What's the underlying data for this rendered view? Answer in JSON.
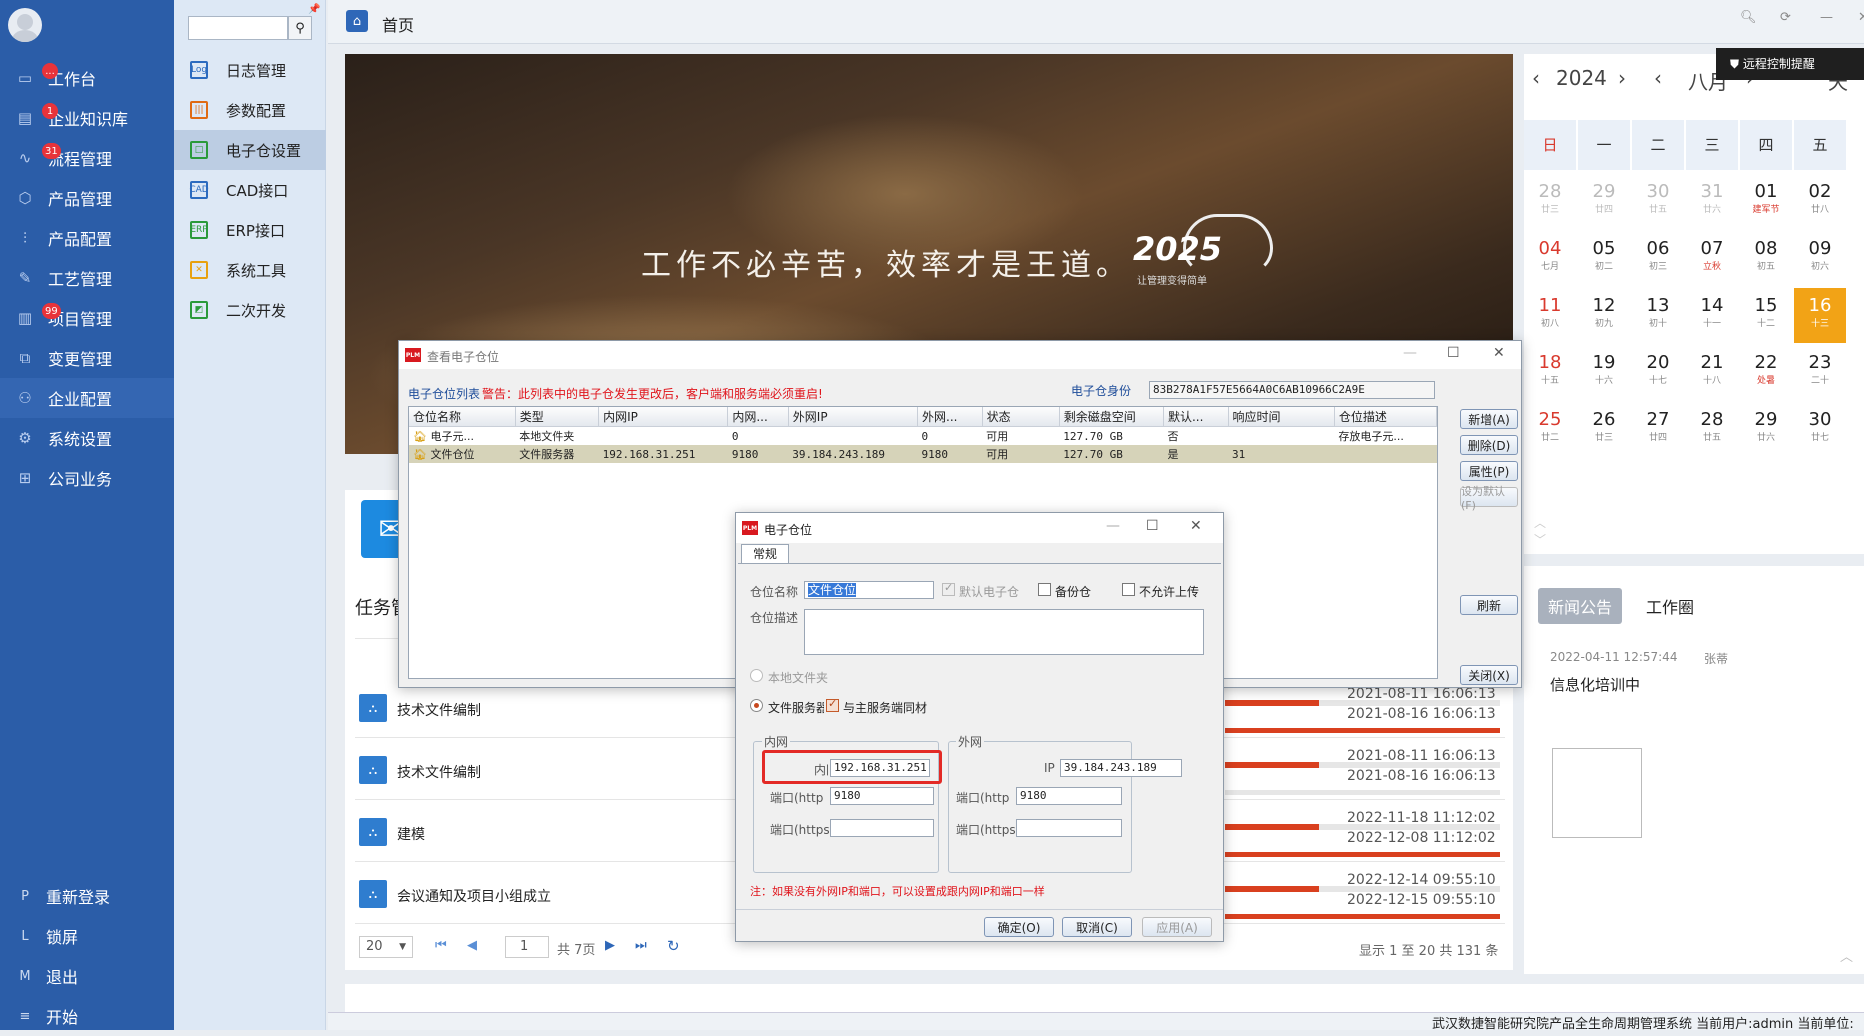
{
  "sidebar": {
    "items": [
      {
        "label": "工作台",
        "badge": "..."
      },
      {
        "label": "企业知识库",
        "badge": "1"
      },
      {
        "label": "流程管理",
        "badge": "31"
      },
      {
        "label": "产品管理",
        "badge": ""
      },
      {
        "label": "产品配置",
        "badge": ""
      },
      {
        "label": "工艺管理",
        "badge": ""
      },
      {
        "label": "项目管理",
        "badge": "99"
      },
      {
        "label": "变更管理",
        "badge": ""
      },
      {
        "label": "企业配置",
        "badge": ""
      },
      {
        "label": "系统设置",
        "badge": ""
      },
      {
        "label": "公司业务",
        "badge": ""
      }
    ],
    "footer": [
      {
        "key": "P",
        "label": "重新登录"
      },
      {
        "key": "L",
        "label": "锁屏"
      },
      {
        "key": "M",
        "label": "退出"
      },
      {
        "key": "≡",
        "label": "开始"
      }
    ]
  },
  "subnav": {
    "items": [
      "日志管理",
      "参数配置",
      "电子仓设置",
      "CAD接口",
      "ERP接口",
      "系统工具",
      "二次开发"
    ],
    "icons": [
      "Log",
      "|||",
      "□",
      "CAD",
      "ERP",
      "✕",
      "◩"
    ]
  },
  "topbar": {
    "title": "首页"
  },
  "banner": {
    "slogan": "工作不必辛苦，效率才是王道。",
    "logo": "2025",
    "logo_sub": "让管理变得简单"
  },
  "calendar": {
    "year": "2024",
    "month": "八月",
    "next": "天",
    "days": [
      "日",
      "一",
      "二",
      "三",
      "四",
      "五"
    ],
    "weeks": [
      [
        [
          "28",
          "廿三",
          "o"
        ],
        [
          "29",
          "廿四",
          "o"
        ],
        [
          "30",
          "廿五",
          "o"
        ],
        [
          "31",
          "廿六",
          "o"
        ],
        [
          "01",
          "建军节",
          "hr"
        ],
        [
          "02",
          "廿八",
          ""
        ]
      ],
      [
        [
          "04",
          "七月",
          "r"
        ],
        [
          "05",
          "初二",
          ""
        ],
        [
          "06",
          "初三",
          ""
        ],
        [
          "07",
          "立秋",
          "hr"
        ],
        [
          "08",
          "初五",
          ""
        ],
        [
          "09",
          "初六",
          ""
        ]
      ],
      [
        [
          "11",
          "初八",
          "r"
        ],
        [
          "12",
          "初九",
          ""
        ],
        [
          "13",
          "初十",
          ""
        ],
        [
          "14",
          "十一",
          ""
        ],
        [
          "15",
          "十二",
          ""
        ],
        [
          "16",
          "十三",
          "t"
        ]
      ],
      [
        [
          "18",
          "十五",
          "r"
        ],
        [
          "19",
          "十六",
          ""
        ],
        [
          "20",
          "十七",
          ""
        ],
        [
          "21",
          "十八",
          ""
        ],
        [
          "22",
          "处暑",
          "hr"
        ],
        [
          "23",
          "二十",
          ""
        ]
      ],
      [
        [
          "25",
          "廿二",
          "r"
        ],
        [
          "26",
          "廿三",
          ""
        ],
        [
          "27",
          "廿四",
          ""
        ],
        [
          "28",
          "廿五",
          ""
        ],
        [
          "29",
          "廿六",
          ""
        ],
        [
          "30",
          "廿七",
          ""
        ]
      ]
    ]
  },
  "remote_tip": "远程控制提醒",
  "news": {
    "tabs": [
      "新闻公告",
      "工作圈"
    ],
    "date": "2022-04-11 12:57:44",
    "author": "张蒂",
    "title": "信息化培训中"
  },
  "tasks": {
    "title": "任务管",
    "rows": [
      {
        "name": "技术文件编制",
        "t1": "2021-08-11 16:06:13",
        "t2": "2021-08-16 16:06:13",
        "p1": 0.34,
        "p2": 1
      },
      {
        "name": "技术文件编制",
        "t1": "2021-08-11 16:06:13",
        "t2": "2021-08-16 16:06:13",
        "p1": 0.34,
        "p2": 0
      },
      {
        "name": "建模",
        "t1": "2022-11-18 11:12:02",
        "t2": "2022-12-08 11:12:02",
        "p1": 0.34,
        "p2": 1
      },
      {
        "name": "会议通知及项目小组成立",
        "t1": "2022-12-14 09:55:10",
        "t2": "2022-12-15 09:55:10",
        "p1": 0.34,
        "p2": 1
      }
    ]
  },
  "pager": {
    "size": "20",
    "page": "1",
    "total_pages": "共 7页",
    "summary": "显示 1 至 20 共 131 条"
  },
  "statusbar": "武汉数捷智能研究院产品全生命周期管理系统 当前用户:admin    当前单位:",
  "dlg1": {
    "title": "查看电子仓位",
    "list_label": "电子仓位列表",
    "warning": "警告：此列表中的电子仓发生更改后，客户端和服务端必须重启!",
    "id_label": "电子仓身份",
    "id_value": "83B278A1F57E5664A0C6AB10966C2A9E",
    "columns": [
      "仓位名称",
      "类型",
      "内网IP",
      "内网...",
      "外网IP",
      "外网...",
      "状态",
      "剩余磁盘空间",
      "默认...",
      "响应时间",
      "仓位描述"
    ],
    "rows": [
      [
        "电子元...",
        "本地文件夹",
        "",
        "0",
        "",
        "0",
        "可用",
        "127.70 GB",
        "否",
        "",
        "存放电子元..."
      ],
      [
        "文件仓位",
        "文件服务器",
        "192.168.31.251",
        "9180",
        "39.184.243.189",
        "9180",
        "可用",
        "127.70 GB",
        "是",
        "31",
        ""
      ]
    ],
    "buttons": {
      "add": "新增(A)",
      "delete": "删除(D)",
      "props": "属性(P)",
      "set_default": "设为默认(F)",
      "refresh": "刷新",
      "close": "关闭(X)"
    }
  },
  "dlg2": {
    "title": "电子仓位",
    "tab": "常规",
    "name_label": "仓位名称",
    "name_value": "文件仓位",
    "default_label": "默认电子仓",
    "backup_label": "备份仓",
    "noupload_label": "不允许上传",
    "desc_label": "仓位描述",
    "local_label": "本地文件夹",
    "server_label": "文件服务器",
    "sync_label": "与主服务端同材",
    "lan": {
      "title": "内网",
      "ip_label": "内网",
      "ip": "192.168.31.251",
      "http_label": "端口(http",
      "http": "9180",
      "https_label": "端口(https",
      "https": ""
    },
    "wan": {
      "title": "外网",
      "ip_label": "IP",
      "ip": "39.184.243.189",
      "http_label": "端口(http",
      "http": "9180",
      "https_label": "端口(https",
      "https": ""
    },
    "note": "注：如果没有外网IP和端口，可以设置成跟内网IP和端口一样",
    "ok": "确定(O)",
    "cancel": "取消(C)",
    "apply": "应用(A)"
  }
}
